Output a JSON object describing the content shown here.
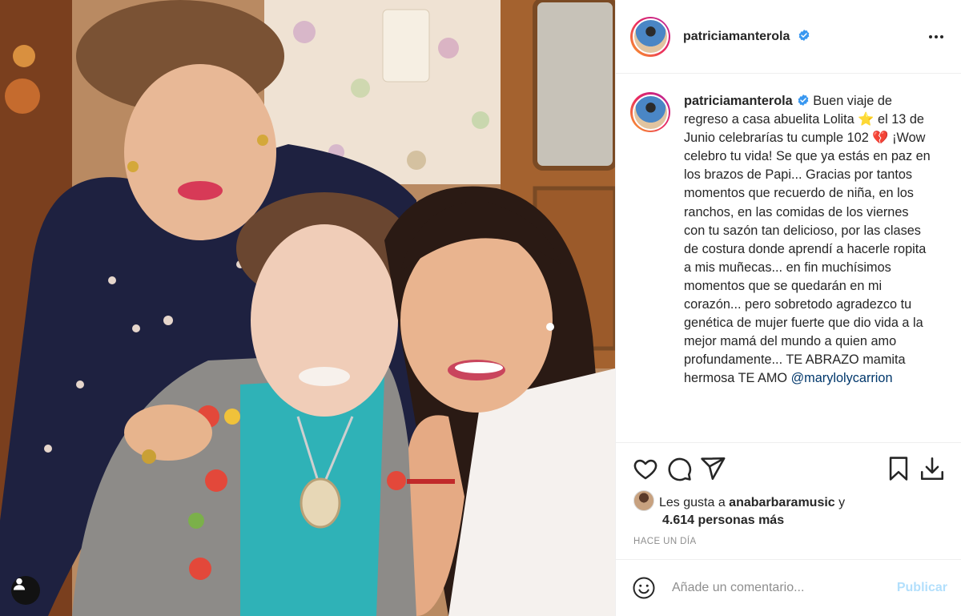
{
  "post": {
    "username": "patriciamanterola",
    "verified": true,
    "more_icon": "more-horizontal-icon"
  },
  "caption": {
    "username": "patriciamanterola",
    "segments": [
      " Buen viaje de regreso a casa abuelita Lolita ",
      "⭐",
      " el 13 de Junio celebrarías tu cumple 102 ",
      "💔",
      " ¡Wow celebro tu vida! Se que ya estás en paz en los brazos de Papi... Gracias por tantos momentos que recuerdo de niña, en los ranchos, en las comidas de los viernes con tu sazón tan delicioso, por las clases de costura donde aprendí a hacerle ropita a mis muñecas... en fin muchísimos momentos que se quedarán en mi corazón... pero sobretodo agradezco tu genética de mujer fuerte que dio vida a la mejor mamá del mundo a quien amo profundamente... TE ABRAZO mamita hermosa TE AMO "
    ],
    "mention": "@marylolycarrion"
  },
  "actions": {
    "like_icon": "heart-icon",
    "comment_icon": "comment-icon",
    "share_icon": "send-icon",
    "save_icon": "bookmark-icon",
    "download_icon": "download-icon"
  },
  "likes": {
    "prefix": "Les gusta a ",
    "user": "anabarbaramusic",
    "connector": " y",
    "count_text": "4.614 personas más"
  },
  "time_ago": "HACE UN DÍA",
  "comment": {
    "placeholder": "Añade un comentario...",
    "publish_label": "Publicar",
    "emoji_icon": "smiley-icon"
  },
  "colors": {
    "verified_blue": "#3897f0",
    "publish_disabled": "#b2dffc",
    "mention": "#00376b"
  }
}
